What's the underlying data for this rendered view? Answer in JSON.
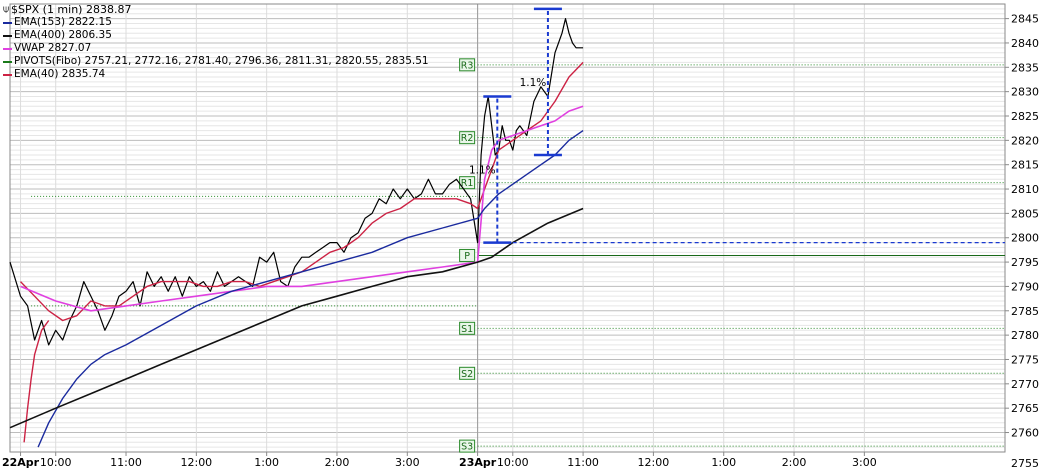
{
  "chart_data": {
    "type": "line",
    "title": "$SPX (1 min) 2838.87",
    "ylim": [
      2756,
      2848
    ],
    "xlim": [
      -0.15,
      14.0
    ],
    "grid": true,
    "legend_placement": "top-left",
    "y_ticks": [
      2760,
      2765,
      2770,
      2775,
      2780,
      2785,
      2790,
      2795,
      2800,
      2805,
      2810,
      2815,
      2820,
      2825,
      2830,
      2835,
      2840,
      2845
    ],
    "bottom_partial_tick": "2755",
    "x_ticks": [
      {
        "x": 0.0,
        "label": "22Apr",
        "bold": true
      },
      {
        "x": 0.5,
        "label": "10:00"
      },
      {
        "x": 1.5,
        "label": "11:00"
      },
      {
        "x": 2.5,
        "label": "12:00"
      },
      {
        "x": 3.5,
        "label": "1:00"
      },
      {
        "x": 4.5,
        "label": "2:00"
      },
      {
        "x": 5.5,
        "label": "3:00"
      },
      {
        "x": 6.5,
        "label": "23Apr",
        "bold": true
      },
      {
        "x": 7.0,
        "label": "10:00"
      },
      {
        "x": 8.0,
        "label": "11:00"
      },
      {
        "x": 9.0,
        "label": "12:00"
      },
      {
        "x": 10.0,
        "label": "1:00"
      },
      {
        "x": 11.0,
        "label": "2:00"
      },
      {
        "x": 12.0,
        "label": "3:00"
      }
    ],
    "session_divider_x": 6.5,
    "legend": [
      {
        "label": "EMA(153) 2822.15",
        "color": "#1a2a9e"
      },
      {
        "label": "EMA(400) 2806.35",
        "color": "#111111"
      },
      {
        "label": "VWAP 2827.07",
        "color": "#e040e0"
      },
      {
        "label": "PIVOTS(Fibo) 2757.21, 2772.16, 2781.40, 2796.36, 2811.31, 2820.55, 2835.51",
        "color": "#1a7a1a"
      },
      {
        "label": "EMA(40) 2835.74",
        "color": "#cc2244"
      }
    ],
    "pivots_prev": [
      {
        "name": "",
        "value": 2808.5
      },
      {
        "name": "",
        "value": 2786.0
      }
    ],
    "pivots": [
      {
        "name": "R3",
        "value": 2835.51
      },
      {
        "name": "R2",
        "value": 2820.55
      },
      {
        "name": "R1",
        "value": 2811.31
      },
      {
        "name": "P",
        "value": 2796.36
      },
      {
        "name": "S1",
        "value": 2781.4
      },
      {
        "name": "S2",
        "value": 2772.16
      },
      {
        "name": "S3",
        "value": 2757.21
      }
    ],
    "series": [
      {
        "key": "price",
        "color": "#000000",
        "x": [
          -0.15,
          0.0,
          0.1,
          0.2,
          0.3,
          0.4,
          0.5,
          0.6,
          0.7,
          0.8,
          0.9,
          1.0,
          1.1,
          1.2,
          1.3,
          1.4,
          1.5,
          1.6,
          1.7,
          1.8,
          1.9,
          2.0,
          2.1,
          2.2,
          2.3,
          2.4,
          2.5,
          2.6,
          2.7,
          2.8,
          2.9,
          3.0,
          3.1,
          3.2,
          3.3,
          3.4,
          3.5,
          3.6,
          3.7,
          3.8,
          3.9,
          4.0,
          4.1,
          4.2,
          4.3,
          4.4,
          4.5,
          4.6,
          4.7,
          4.8,
          4.9,
          5.0,
          5.1,
          5.2,
          5.3,
          5.4,
          5.5,
          5.6,
          5.7,
          5.8,
          5.9,
          6.0,
          6.1,
          6.2,
          6.3,
          6.4,
          6.5,
          6.55,
          6.6,
          6.65,
          6.7,
          6.75,
          6.8,
          6.85,
          6.9,
          6.95,
          7.0,
          7.05,
          7.1,
          7.2,
          7.3,
          7.4,
          7.5,
          7.6,
          7.65,
          7.7,
          7.75,
          7.8,
          7.85,
          7.9,
          8.0
        ],
        "values": [
          2795,
          2788,
          2786,
          2779,
          2783,
          2778,
          2781,
          2779,
          2783,
          2786,
          2791,
          2788,
          2785,
          2781,
          2784,
          2788,
          2789,
          2791,
          2786,
          2793,
          2790,
          2792,
          2789,
          2792,
          2788,
          2792,
          2790,
          2791,
          2789,
          2793,
          2790,
          2791,
          2792,
          2791,
          2790,
          2796,
          2795,
          2797,
          2791,
          2790,
          2794,
          2796,
          2796,
          2797,
          2798,
          2799,
          2799,
          2797,
          2800,
          2801,
          2804,
          2805,
          2808,
          2807,
          2810,
          2808,
          2810,
          2808,
          2809,
          2812,
          2809,
          2809,
          2811,
          2812,
          2810,
          2808,
          2799,
          2817,
          2825,
          2829,
          2823,
          2817,
          2818,
          2823,
          2820,
          2820,
          2818,
          2822,
          2823,
          2821,
          2828,
          2831,
          2829,
          2838,
          2840,
          2842,
          2845,
          2842,
          2840,
          2839,
          2839
        ]
      },
      {
        "key": "ema40",
        "color": "#cc2244",
        "x": [
          0.0,
          0.2,
          0.4,
          0.6,
          0.8,
          1.0,
          1.2,
          1.4,
          1.6,
          1.8,
          2.0,
          2.2,
          2.4,
          2.6,
          2.8,
          3.0,
          3.2,
          3.4,
          3.6,
          3.8,
          4.0,
          4.2,
          4.4,
          4.6,
          4.8,
          5.0,
          5.2,
          5.4,
          5.6,
          5.8,
          6.0,
          6.2,
          6.4,
          6.5,
          6.6,
          6.7,
          6.8,
          7.0,
          7.2,
          7.4,
          7.6,
          7.8,
          8.0
        ],
        "values": [
          2791,
          2788,
          2785,
          2783,
          2784,
          2787,
          2786,
          2786,
          2788,
          2790,
          2791,
          2791,
          2791,
          2790,
          2790,
          2791,
          2791,
          2790,
          2791,
          2792,
          2793,
          2795,
          2797,
          2798,
          2800,
          2803,
          2805,
          2806,
          2808,
          2808,
          2808,
          2808,
          2807,
          2806,
          2810,
          2814,
          2818,
          2820,
          2822,
          2824,
          2828,
          2833,
          2836
        ]
      },
      {
        "key": "ema40_early",
        "color": "#cc2244",
        "x": [
          0.05,
          0.1,
          0.15,
          0.2,
          0.3,
          0.4
        ],
        "values": [
          2758,
          2765,
          2771,
          2776,
          2781,
          2783
        ]
      },
      {
        "key": "vwap",
        "color": "#e040e0",
        "x": [
          0.0,
          0.5,
          1.0,
          1.5,
          2.0,
          2.5,
          3.0,
          3.5,
          4.0,
          4.5,
          5.0,
          5.5,
          6.0,
          6.5,
          6.6,
          6.7,
          6.8,
          7.0,
          7.2,
          7.4,
          7.6,
          7.8,
          8.0
        ],
        "values": [
          2790,
          2787,
          2785,
          2786,
          2787,
          2788,
          2789,
          2790,
          2790,
          2791,
          2792,
          2793,
          2794,
          2795,
          2812,
          2818,
          2820,
          2821,
          2822,
          2823,
          2824,
          2826,
          2827
        ]
      },
      {
        "key": "ema153",
        "color": "#1a2a9e",
        "x": [
          0.25,
          0.4,
          0.6,
          0.8,
          1.0,
          1.2,
          1.5,
          2.0,
          2.5,
          3.0,
          3.5,
          4.0,
          4.5,
          5.0,
          5.5,
          6.0,
          6.5,
          6.6,
          6.8,
          7.0,
          7.2,
          7.4,
          7.6,
          7.8,
          8.0
        ],
        "values": [
          2757,
          2762,
          2767,
          2771,
          2774,
          2776,
          2778,
          2782,
          2786,
          2789,
          2791,
          2793,
          2795,
          2797,
          2800,
          2802,
          2804,
          2806,
          2809,
          2811,
          2813,
          2815,
          2817,
          2820,
          2822
        ]
      },
      {
        "key": "ema400",
        "color": "#111111",
        "x": [
          -0.15,
          0.5,
          1.0,
          1.5,
          2.0,
          2.5,
          3.0,
          3.5,
          4.0,
          4.5,
          5.0,
          5.5,
          6.0,
          6.5,
          6.7,
          7.0,
          7.5,
          8.0
        ],
        "values": [
          2761,
          2765,
          2768,
          2771,
          2774,
          2777,
          2780,
          2783,
          2786,
          2788,
          2790,
          2792,
          2793,
          2795,
          2796,
          2799,
          2803,
          2806
        ]
      }
    ],
    "annotations": [
      {
        "type": "bracket",
        "x": 6.78,
        "y1": 2799,
        "y2": 2829,
        "label": "1.1%"
      },
      {
        "type": "bracket",
        "x": 7.5,
        "y1": 2817,
        "y2": 2847,
        "label": "1.1%"
      },
      {
        "type": "hline_dashed",
        "x1": 6.6,
        "x2": 14.0,
        "y": 2799,
        "color": "#1a3ad0"
      }
    ]
  }
}
